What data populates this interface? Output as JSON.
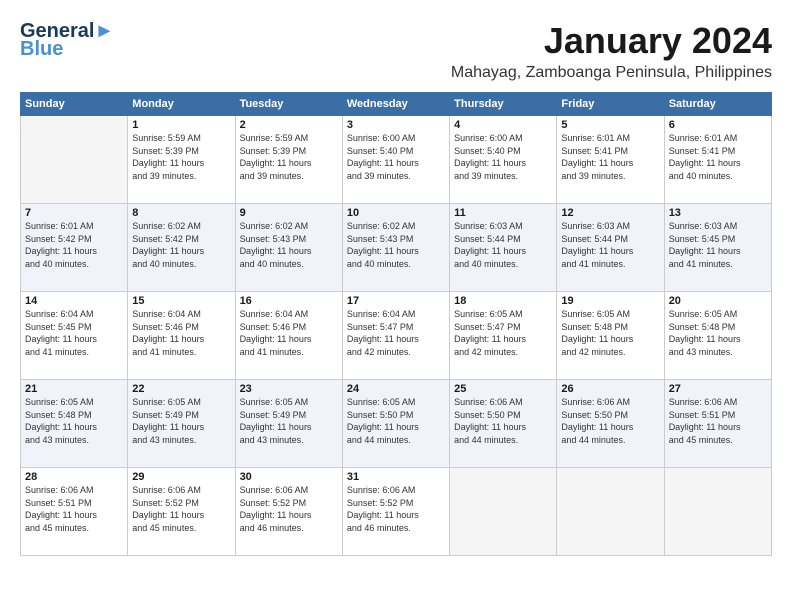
{
  "header": {
    "logo_line1": "General",
    "logo_line2": "Blue",
    "month_title": "January 2024",
    "location": "Mahayag, Zamboanga Peninsula, Philippines"
  },
  "weekdays": [
    "Sunday",
    "Monday",
    "Tuesday",
    "Wednesday",
    "Thursday",
    "Friday",
    "Saturday"
  ],
  "weeks": [
    [
      {
        "day": "",
        "info": ""
      },
      {
        "day": "1",
        "info": "Sunrise: 5:59 AM\nSunset: 5:39 PM\nDaylight: 11 hours\nand 39 minutes."
      },
      {
        "day": "2",
        "info": "Sunrise: 5:59 AM\nSunset: 5:39 PM\nDaylight: 11 hours\nand 39 minutes."
      },
      {
        "day": "3",
        "info": "Sunrise: 6:00 AM\nSunset: 5:40 PM\nDaylight: 11 hours\nand 39 minutes."
      },
      {
        "day": "4",
        "info": "Sunrise: 6:00 AM\nSunset: 5:40 PM\nDaylight: 11 hours\nand 39 minutes."
      },
      {
        "day": "5",
        "info": "Sunrise: 6:01 AM\nSunset: 5:41 PM\nDaylight: 11 hours\nand 39 minutes."
      },
      {
        "day": "6",
        "info": "Sunrise: 6:01 AM\nSunset: 5:41 PM\nDaylight: 11 hours\nand 40 minutes."
      }
    ],
    [
      {
        "day": "7",
        "info": "Sunrise: 6:01 AM\nSunset: 5:42 PM\nDaylight: 11 hours\nand 40 minutes."
      },
      {
        "day": "8",
        "info": "Sunrise: 6:02 AM\nSunset: 5:42 PM\nDaylight: 11 hours\nand 40 minutes."
      },
      {
        "day": "9",
        "info": "Sunrise: 6:02 AM\nSunset: 5:43 PM\nDaylight: 11 hours\nand 40 minutes."
      },
      {
        "day": "10",
        "info": "Sunrise: 6:02 AM\nSunset: 5:43 PM\nDaylight: 11 hours\nand 40 minutes."
      },
      {
        "day": "11",
        "info": "Sunrise: 6:03 AM\nSunset: 5:44 PM\nDaylight: 11 hours\nand 40 minutes."
      },
      {
        "day": "12",
        "info": "Sunrise: 6:03 AM\nSunset: 5:44 PM\nDaylight: 11 hours\nand 41 minutes."
      },
      {
        "day": "13",
        "info": "Sunrise: 6:03 AM\nSunset: 5:45 PM\nDaylight: 11 hours\nand 41 minutes."
      }
    ],
    [
      {
        "day": "14",
        "info": "Sunrise: 6:04 AM\nSunset: 5:45 PM\nDaylight: 11 hours\nand 41 minutes."
      },
      {
        "day": "15",
        "info": "Sunrise: 6:04 AM\nSunset: 5:46 PM\nDaylight: 11 hours\nand 41 minutes."
      },
      {
        "day": "16",
        "info": "Sunrise: 6:04 AM\nSunset: 5:46 PM\nDaylight: 11 hours\nand 41 minutes."
      },
      {
        "day": "17",
        "info": "Sunrise: 6:04 AM\nSunset: 5:47 PM\nDaylight: 11 hours\nand 42 minutes."
      },
      {
        "day": "18",
        "info": "Sunrise: 6:05 AM\nSunset: 5:47 PM\nDaylight: 11 hours\nand 42 minutes."
      },
      {
        "day": "19",
        "info": "Sunrise: 6:05 AM\nSunset: 5:48 PM\nDaylight: 11 hours\nand 42 minutes."
      },
      {
        "day": "20",
        "info": "Sunrise: 6:05 AM\nSunset: 5:48 PM\nDaylight: 11 hours\nand 43 minutes."
      }
    ],
    [
      {
        "day": "21",
        "info": "Sunrise: 6:05 AM\nSunset: 5:48 PM\nDaylight: 11 hours\nand 43 minutes."
      },
      {
        "day": "22",
        "info": "Sunrise: 6:05 AM\nSunset: 5:49 PM\nDaylight: 11 hours\nand 43 minutes."
      },
      {
        "day": "23",
        "info": "Sunrise: 6:05 AM\nSunset: 5:49 PM\nDaylight: 11 hours\nand 43 minutes."
      },
      {
        "day": "24",
        "info": "Sunrise: 6:05 AM\nSunset: 5:50 PM\nDaylight: 11 hours\nand 44 minutes."
      },
      {
        "day": "25",
        "info": "Sunrise: 6:06 AM\nSunset: 5:50 PM\nDaylight: 11 hours\nand 44 minutes."
      },
      {
        "day": "26",
        "info": "Sunrise: 6:06 AM\nSunset: 5:50 PM\nDaylight: 11 hours\nand 44 minutes."
      },
      {
        "day": "27",
        "info": "Sunrise: 6:06 AM\nSunset: 5:51 PM\nDaylight: 11 hours\nand 45 minutes."
      }
    ],
    [
      {
        "day": "28",
        "info": "Sunrise: 6:06 AM\nSunset: 5:51 PM\nDaylight: 11 hours\nand 45 minutes."
      },
      {
        "day": "29",
        "info": "Sunrise: 6:06 AM\nSunset: 5:52 PM\nDaylight: 11 hours\nand 45 minutes."
      },
      {
        "day": "30",
        "info": "Sunrise: 6:06 AM\nSunset: 5:52 PM\nDaylight: 11 hours\nand 46 minutes."
      },
      {
        "day": "31",
        "info": "Sunrise: 6:06 AM\nSunset: 5:52 PM\nDaylight: 11 hours\nand 46 minutes."
      },
      {
        "day": "",
        "info": ""
      },
      {
        "day": "",
        "info": ""
      },
      {
        "day": "",
        "info": ""
      }
    ]
  ]
}
